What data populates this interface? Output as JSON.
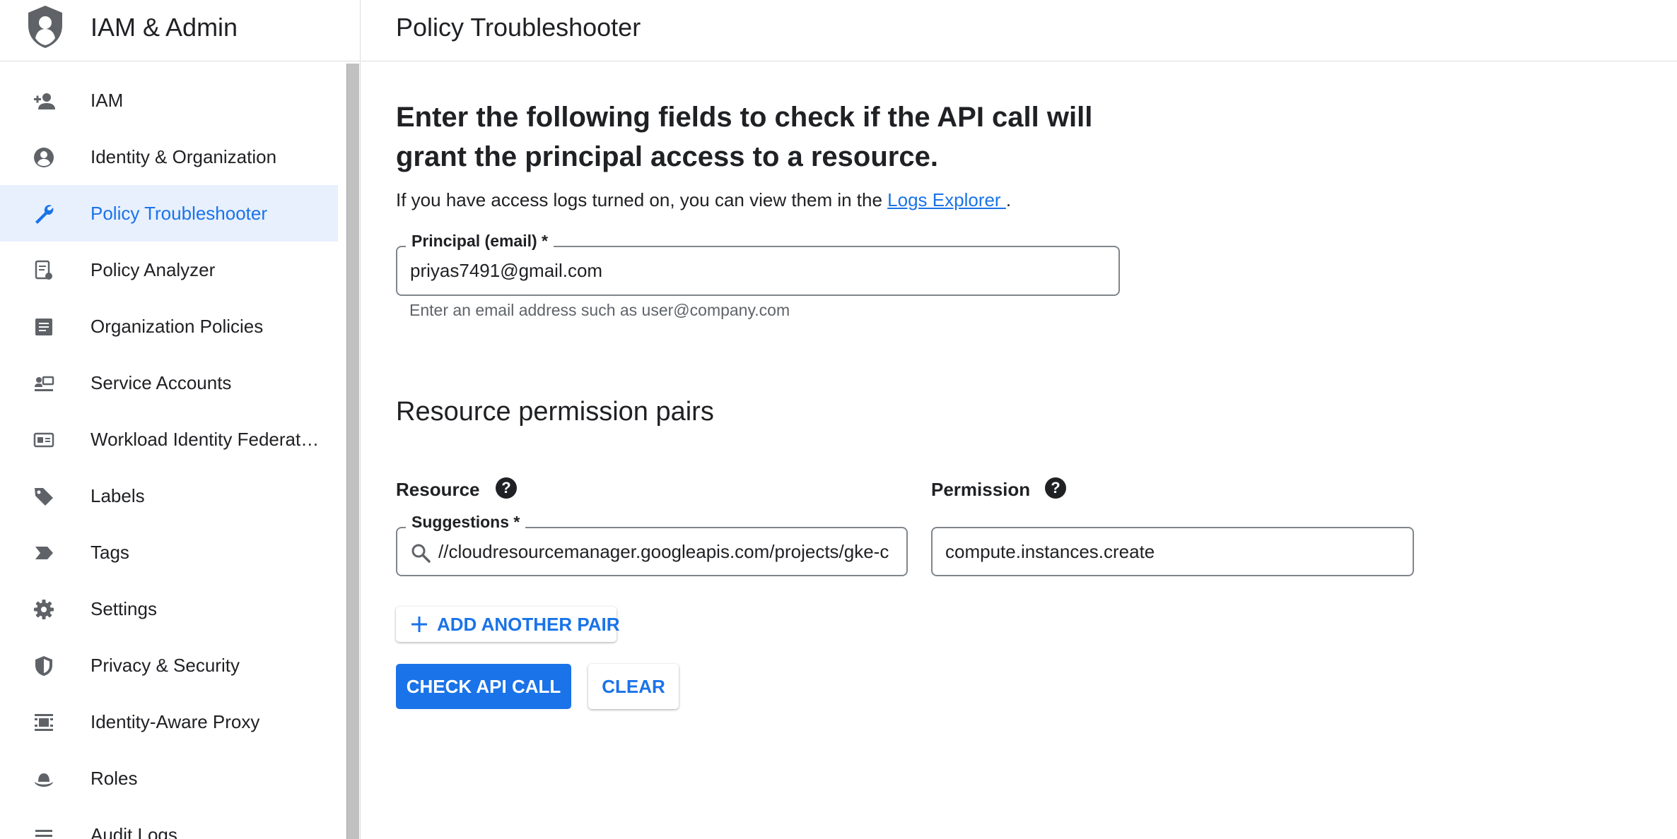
{
  "app": {
    "title": "IAM & Admin"
  },
  "page": {
    "title": "Policy Troubleshooter"
  },
  "sidebar": {
    "items": [
      {
        "label": "IAM",
        "icon": "person-add-icon"
      },
      {
        "label": "Identity & Organization",
        "icon": "account-circle-icon"
      },
      {
        "label": "Policy Troubleshooter",
        "icon": "wrench-icon",
        "active": true
      },
      {
        "label": "Policy Analyzer",
        "icon": "policy-doc-icon"
      },
      {
        "label": "Organization Policies",
        "icon": "list-doc-icon"
      },
      {
        "label": "Service Accounts",
        "icon": "service-account-icon"
      },
      {
        "label": "Workload Identity Federat…",
        "icon": "id-card-icon"
      },
      {
        "label": "Labels",
        "icon": "tag-icon"
      },
      {
        "label": "Tags",
        "icon": "label-arrow-icon"
      },
      {
        "label": "Settings",
        "icon": "gear-icon"
      },
      {
        "label": "Privacy & Security",
        "icon": "shield-icon"
      },
      {
        "label": "Identity-Aware Proxy",
        "icon": "proxy-icon"
      },
      {
        "label": "Roles",
        "icon": "hat-icon"
      },
      {
        "label": "Audit Logs",
        "icon": "lines-icon"
      }
    ]
  },
  "main": {
    "heading": "Enter the following fields to check if the API call will grant the principal access to a resource.",
    "logs_prefix": "If you have access logs turned on, you can view them in the ",
    "logs_link": "Logs Explorer ",
    "logs_suffix": ".",
    "principal": {
      "label": "Principal (email) *",
      "value": "priyas7491@gmail.com",
      "hint": "Enter an email address such as user@company.com"
    },
    "section_title": "Resource permission pairs",
    "resource": {
      "col_label": "Resource",
      "label": "Suggestions *",
      "value": "//cloudresourcemanager.googleapis.com/projects/gke-c"
    },
    "permission": {
      "col_label": "Permission",
      "value": "compute.instances.create"
    },
    "help_glyph": "?",
    "buttons": {
      "add_pair": "ADD ANOTHER PAIR",
      "check": "CHECK API CALL",
      "clear": "CLEAR"
    }
  },
  "colors": {
    "accent": "#1a73e8",
    "active_bg": "#e8f0fe"
  }
}
